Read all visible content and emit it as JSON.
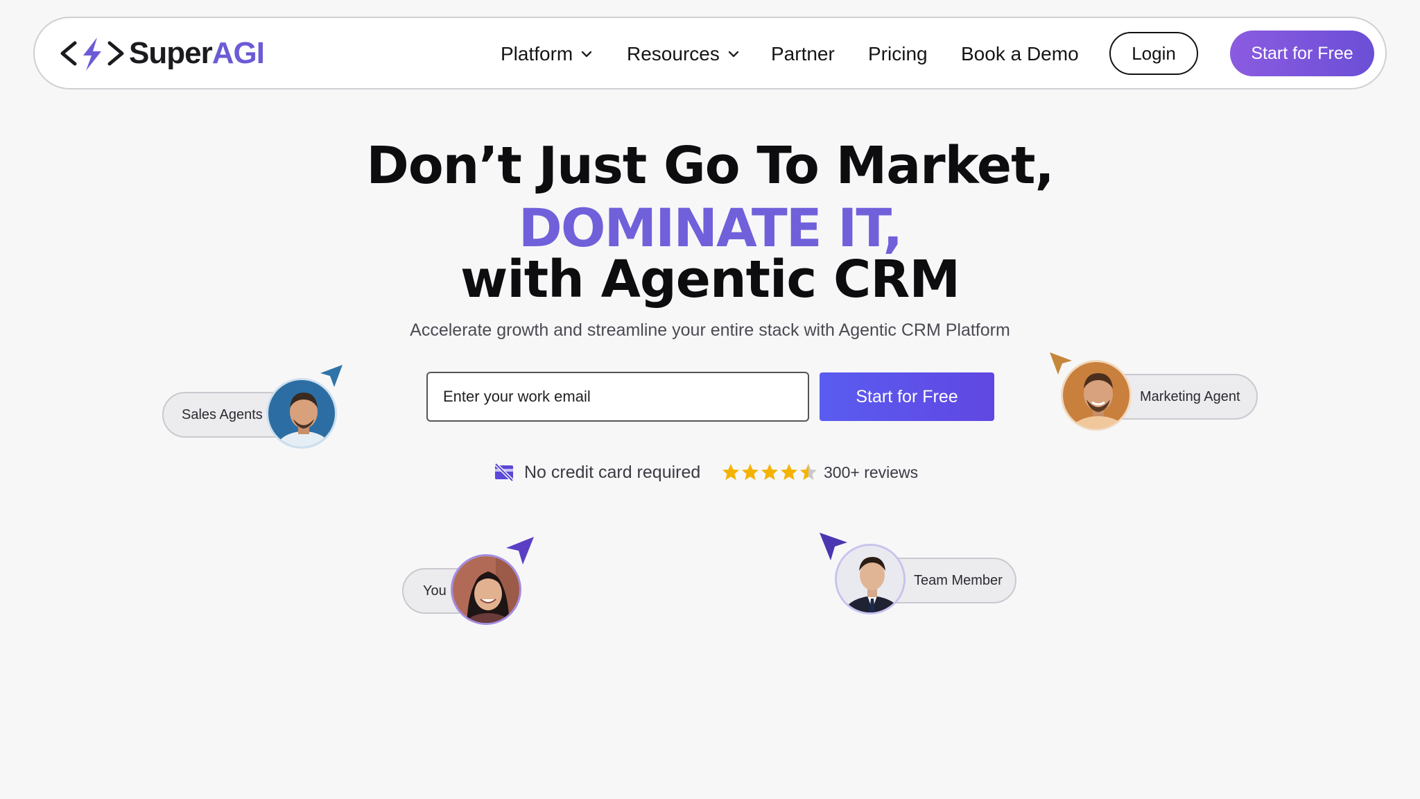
{
  "nav": {
    "logo_prefix": "Super",
    "logo_suffix": "AGI",
    "links": [
      {
        "label": "Platform",
        "has_dropdown": true
      },
      {
        "label": "Resources",
        "has_dropdown": true
      },
      {
        "label": "Partner",
        "has_dropdown": false
      },
      {
        "label": "Pricing",
        "has_dropdown": false
      },
      {
        "label": "Book a Demo",
        "has_dropdown": false
      }
    ],
    "login_label": "Login",
    "cta_label": "Start for Free"
  },
  "hero": {
    "line1": "Don’t Just Go To Market,",
    "line2": "DOMINATE IT,",
    "line3": "with Agentic CRM",
    "subtitle": "Accelerate growth and streamline your entire stack with Agentic CRM Platform",
    "email_placeholder": "Enter your work email",
    "cta_label": "Start for Free",
    "no_card_text": "No credit card required",
    "rating_stars": 4.5,
    "reviews_text": "300+ reviews"
  },
  "agents": [
    {
      "label": "Sales Agents",
      "cursor_color": "#2f74a8"
    },
    {
      "label": "Marketing Agent",
      "cursor_color": "#c5873b"
    },
    {
      "label": "You",
      "cursor_color": "#5a3fc4"
    },
    {
      "label": "Team Member",
      "cursor_color": "#4a36b0"
    }
  ],
  "colors": {
    "accent": "#7060da",
    "cta_gradient_start": "#5a5cf0",
    "cta_gradient_end": "#6047e2",
    "nav_cta_start": "#8b5be0",
    "star": "#f5b301"
  }
}
